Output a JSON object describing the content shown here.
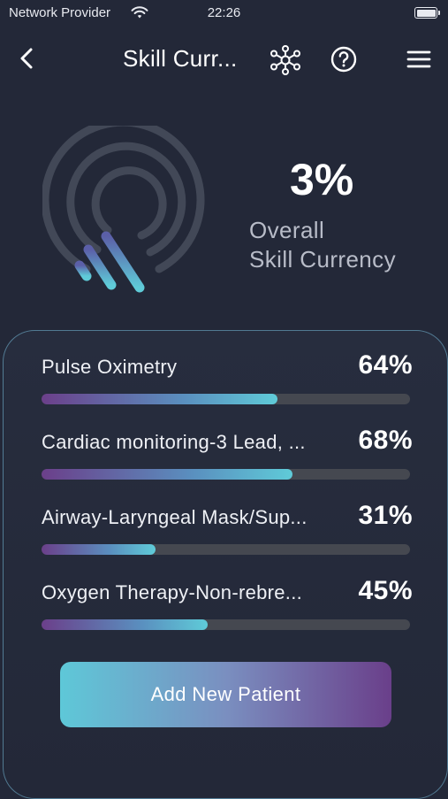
{
  "status_bar": {
    "provider": "Network Provider",
    "time": "22:26"
  },
  "nav": {
    "title": "Skill Curr...",
    "icons": [
      "back-chevron-icon",
      "network-nodes-icon",
      "help-circle-icon",
      "hamburger-menu-icon"
    ]
  },
  "summary": {
    "percent": "3%",
    "label_line1": "Overall",
    "label_line2": "Skill Currency",
    "progress": 0.03
  },
  "skills": [
    {
      "name": "Pulse Oximetry",
      "percent_label": "64%",
      "progress": 0.64
    },
    {
      "name": "Cardiac monitoring-3 Lead, ...",
      "percent_label": "68%",
      "progress": 0.68
    },
    {
      "name": "Airway-Laryngeal Mask/Sup...",
      "percent_label": "31%",
      "progress": 0.31
    },
    {
      "name": "Oxygen Therapy-Non-rebre...",
      "percent_label": "45%",
      "progress": 0.45
    }
  ],
  "actions": {
    "add_patient_label": "Add New Patient"
  },
  "colors": {
    "background": "#232838",
    "accent_teal": "#5fcbd8",
    "accent_purple": "#6a3f8a",
    "track": "#454850"
  }
}
